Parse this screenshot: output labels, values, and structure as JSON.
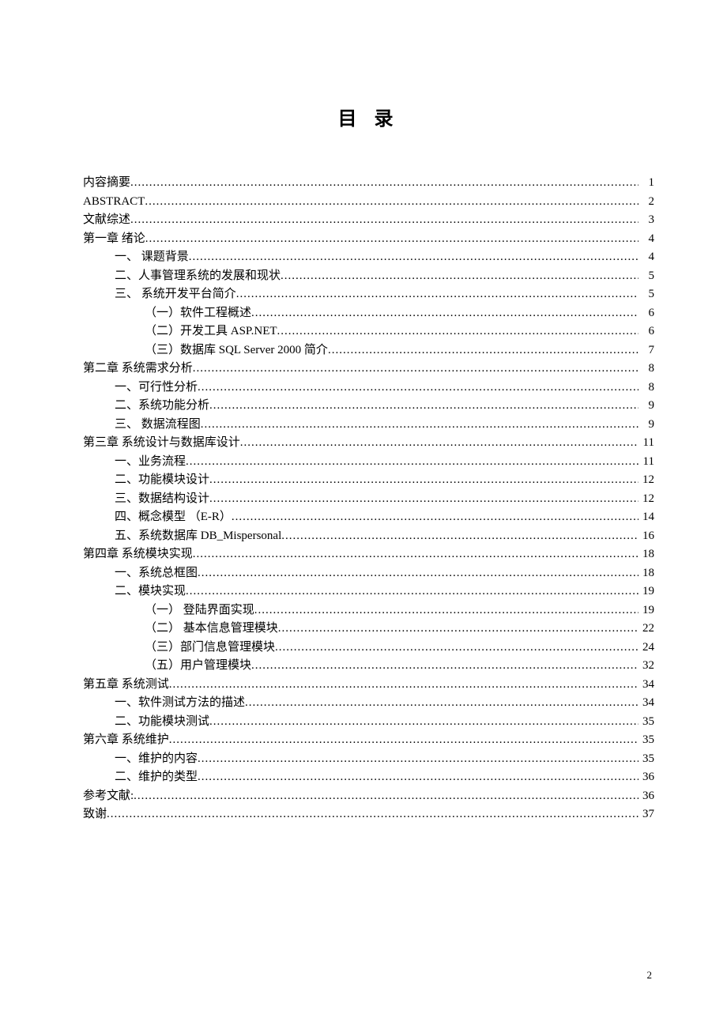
{
  "title": "目 录",
  "page_number": "2",
  "entries": [
    {
      "indent": 0,
      "label": "内容摘要 ",
      "page": "1"
    },
    {
      "indent": 0,
      "label": "ABSTRACT ",
      "page": "2"
    },
    {
      "indent": 0,
      "label": "文献综述 ",
      "page": "3"
    },
    {
      "indent": 0,
      "label": "第一章  绪论 ",
      "page": "4"
    },
    {
      "indent": 1,
      "label": "一、  课题背景 ",
      "page": "4"
    },
    {
      "indent": 1,
      "label": "二、人事管理系统的发展和现状 ",
      "page": "5"
    },
    {
      "indent": 1,
      "label": "三、  系统开发平台简介 ",
      "page": "5"
    },
    {
      "indent": 2,
      "label": "（一）软件工程概述 ",
      "page": "6"
    },
    {
      "indent": 2,
      "label": "（二）开发工具 ASP.NET ",
      "page": "6"
    },
    {
      "indent": 2,
      "label": "（三）数据库 SQL Server 2000 简介 ",
      "page": "7"
    },
    {
      "indent": 0,
      "label": "第二章  系统需求分析 ",
      "page": "8"
    },
    {
      "indent": 1,
      "label": "一、可行性分析 ",
      "page": "8"
    },
    {
      "indent": 1,
      "label": "二、系统功能分析 ",
      "page": "9"
    },
    {
      "indent": 1,
      "label": "三、  数据流程图 ",
      "page": "9"
    },
    {
      "indent": 0,
      "label": "第三章  系统设计与数据库设计 ",
      "page": "11"
    },
    {
      "indent": 1,
      "label": "一、业务流程 ",
      "page": "11"
    },
    {
      "indent": 1,
      "label": "二、功能模块设计 ",
      "page": "12"
    },
    {
      "indent": 1,
      "label": "三、数据结构设计 ",
      "page": "12"
    },
    {
      "indent": 1,
      "label": "四、概念模型 （E-R） ",
      "page": "14"
    },
    {
      "indent": 1,
      "label": "五、系统数据库 DB_Mispersonal ",
      "page": "16"
    },
    {
      "indent": 0,
      "label": "第四章  系统模块实现 ",
      "page": "18"
    },
    {
      "indent": 1,
      "label": "一、系统总框图 ",
      "page": "18"
    },
    {
      "indent": 1,
      "label": "二、模块实现 ",
      "page": "19"
    },
    {
      "indent": 2,
      "label": "（一）  登陆界面实现 ",
      "page": "19"
    },
    {
      "indent": 2,
      "label": "（二）  基本信息管理模块 ",
      "page": "22"
    },
    {
      "indent": 2,
      "label": "（三）部门信息管理模块 ",
      "page": "24"
    },
    {
      "indent": 2,
      "label": "（五）用户管理模块 ",
      "page": "32"
    },
    {
      "indent": 0,
      "label": "第五章  系统测试 ",
      "page": "34"
    },
    {
      "indent": 1,
      "label": "一、软件测试方法的描述 ",
      "page": "34"
    },
    {
      "indent": 1,
      "label": "二、功能模块测试 ",
      "page": "35"
    },
    {
      "indent": 0,
      "label": "第六章  系统维护 ",
      "page": "35"
    },
    {
      "indent": 1,
      "label": "一、维护的内容 ",
      "page": "35"
    },
    {
      "indent": 1,
      "label": "二、维护的类型 ",
      "page": "36"
    },
    {
      "indent": 0,
      "label": "参考文献:  ",
      "page": "36"
    },
    {
      "indent": 0,
      "label": "致谢 ",
      "page": "37"
    }
  ]
}
